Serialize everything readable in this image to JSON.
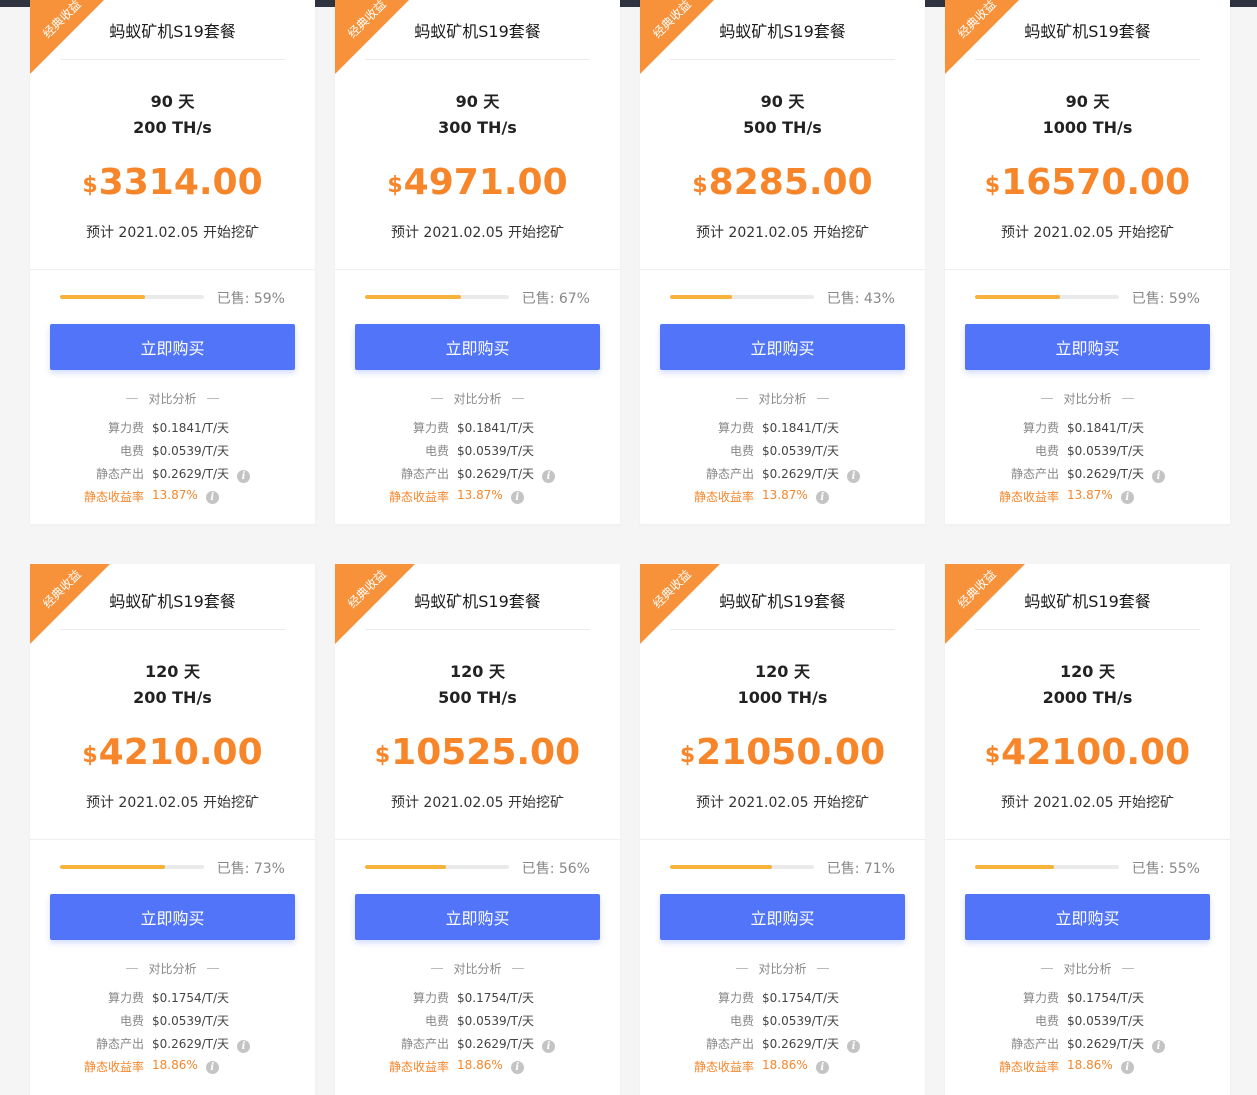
{
  "ribbon_label": "经典收益",
  "compare_label": "对比分析",
  "buy_label": "立即购买",
  "rows": [
    {
      "cards": [
        {
          "title": "蚂蚁矿机S19套餐",
          "days": "90 天",
          "hashrate": "200 TH/s",
          "currency": "$",
          "price": "3314.00",
          "start": "预计 2021.02.05 开始挖矿",
          "sold_pct": 59,
          "sold_text": "已售: 59%",
          "fee_label": "算力费",
          "fee": "$0.1841/T/天",
          "power_label": "电费",
          "power": "$0.0539/T/天",
          "output_label": "静态产出",
          "output": "$0.2629/T/天",
          "yield_label": "静态收益率",
          "yield": "13.87%"
        },
        {
          "title": "蚂蚁矿机S19套餐",
          "days": "90 天",
          "hashrate": "300 TH/s",
          "currency": "$",
          "price": "4971.00",
          "start": "预计 2021.02.05 开始挖矿",
          "sold_pct": 67,
          "sold_text": "已售: 67%",
          "fee_label": "算力费",
          "fee": "$0.1841/T/天",
          "power_label": "电费",
          "power": "$0.0539/T/天",
          "output_label": "静态产出",
          "output": "$0.2629/T/天",
          "yield_label": "静态收益率",
          "yield": "13.87%"
        },
        {
          "title": "蚂蚁矿机S19套餐",
          "days": "90 天",
          "hashrate": "500 TH/s",
          "currency": "$",
          "price": "8285.00",
          "start": "预计 2021.02.05 开始挖矿",
          "sold_pct": 43,
          "sold_text": "已售: 43%",
          "fee_label": "算力费",
          "fee": "$0.1841/T/天",
          "power_label": "电费",
          "power": "$0.0539/T/天",
          "output_label": "静态产出",
          "output": "$0.2629/T/天",
          "yield_label": "静态收益率",
          "yield": "13.87%"
        },
        {
          "title": "蚂蚁矿机S19套餐",
          "days": "90 天",
          "hashrate": "1000 TH/s",
          "currency": "$",
          "price": "16570.00",
          "start": "预计 2021.02.05 开始挖矿",
          "sold_pct": 59,
          "sold_text": "已售: 59%",
          "fee_label": "算力费",
          "fee": "$0.1841/T/天",
          "power_label": "电费",
          "power": "$0.0539/T/天",
          "output_label": "静态产出",
          "output": "$0.2629/T/天",
          "yield_label": "静态收益率",
          "yield": "13.87%"
        }
      ]
    },
    {
      "cards": [
        {
          "title": "蚂蚁矿机S19套餐",
          "days": "120 天",
          "hashrate": "200 TH/s",
          "currency": "$",
          "price": "4210.00",
          "start": "预计 2021.02.05 开始挖矿",
          "sold_pct": 73,
          "sold_text": "已售: 73%",
          "fee_label": "算力费",
          "fee": "$0.1754/T/天",
          "power_label": "电费",
          "power": "$0.0539/T/天",
          "output_label": "静态产出",
          "output": "$0.2629/T/天",
          "yield_label": "静态收益率",
          "yield": "18.86%"
        },
        {
          "title": "蚂蚁矿机S19套餐",
          "days": "120 天",
          "hashrate": "500 TH/s",
          "currency": "$",
          "price": "10525.00",
          "start": "预计 2021.02.05 开始挖矿",
          "sold_pct": 56,
          "sold_text": "已售: 56%",
          "fee_label": "算力费",
          "fee": "$0.1754/T/天",
          "power_label": "电费",
          "power": "$0.0539/T/天",
          "output_label": "静态产出",
          "output": "$0.2629/T/天",
          "yield_label": "静态收益率",
          "yield": "18.86%"
        },
        {
          "title": "蚂蚁矿机S19套餐",
          "days": "120 天",
          "hashrate": "1000 TH/s",
          "currency": "$",
          "price": "21050.00",
          "start": "预计 2021.02.05 开始挖矿",
          "sold_pct": 71,
          "sold_text": "已售: 71%",
          "fee_label": "算力费",
          "fee": "$0.1754/T/天",
          "power_label": "电费",
          "power": "$0.0539/T/天",
          "output_label": "静态产出",
          "output": "$0.2629/T/天",
          "yield_label": "静态收益率",
          "yield": "18.86%"
        },
        {
          "title": "蚂蚁矿机S19套餐",
          "days": "120 天",
          "hashrate": "2000 TH/s",
          "currency": "$",
          "price": "42100.00",
          "start": "预计 2021.02.05 开始挖矿",
          "sold_pct": 55,
          "sold_text": "已售: 55%",
          "fee_label": "算力费",
          "fee": "$0.1754/T/天",
          "power_label": "电费",
          "power": "$0.0539/T/天",
          "output_label": "静态产出",
          "output": "$0.2629/T/天",
          "yield_label": "静态收益率",
          "yield": "18.86%"
        }
      ]
    }
  ]
}
